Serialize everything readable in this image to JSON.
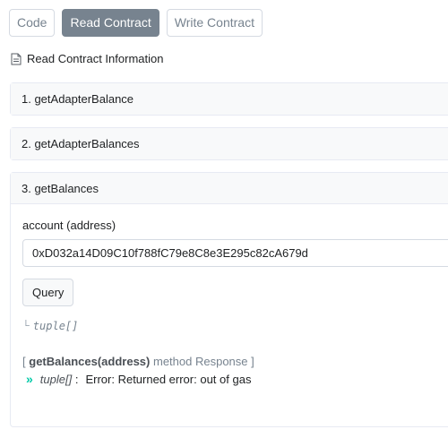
{
  "tabs": [
    {
      "label": "Code",
      "active": false
    },
    {
      "label": "Read Contract",
      "active": true
    },
    {
      "label": "Write Contract",
      "active": false
    }
  ],
  "section": {
    "title": "Read Contract Information",
    "icon": "document-icon"
  },
  "methods": [
    {
      "label": "1. getAdapterBalance",
      "expanded": false
    },
    {
      "label": "2. getAdapterBalances",
      "expanded": false
    },
    {
      "label": "3. getBalances",
      "expanded": true
    }
  ],
  "get_balances": {
    "input_label": "account (address)",
    "input_value": "0xD032a14D09C10f788fC79e8C8e3E295c82cA679d",
    "query_label": "Query",
    "return_type": "tuple[]",
    "response_prefix": "[",
    "response_method": "getBalances(address)",
    "response_suffix": "method Response ]",
    "result_type": "tuple[]",
    "result_separator": ":",
    "result_message": "Error: Returned error: out of gas"
  },
  "colors": {
    "accent": "#77838f",
    "success": "#00c9a7"
  }
}
